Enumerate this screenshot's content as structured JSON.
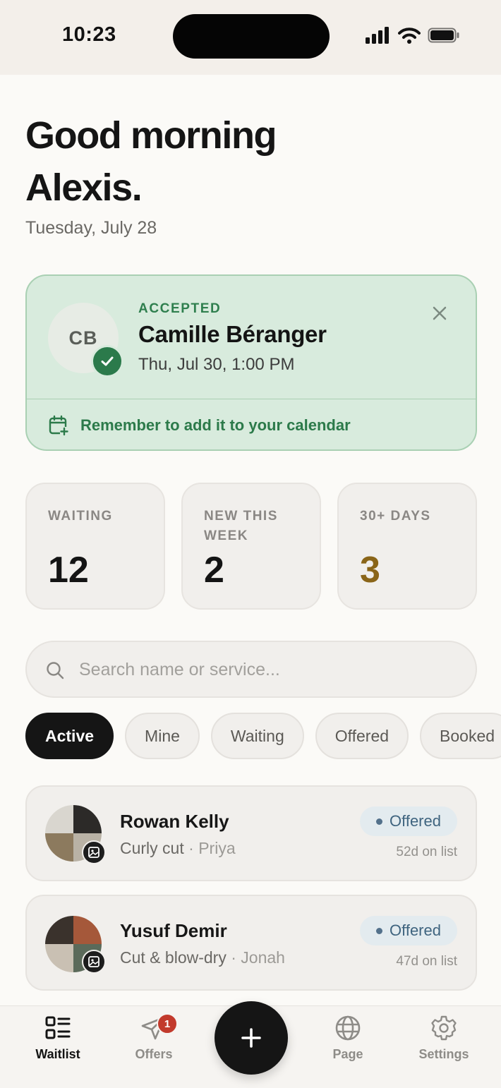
{
  "status_bar": {
    "time": "10:23"
  },
  "header": {
    "greeting_line1": "Good morning",
    "greeting_line2": "Alexis.",
    "date": "Tuesday, July 28"
  },
  "accepted_card": {
    "status_label": "ACCEPTED",
    "initials": "CB",
    "name": "Camille Béranger",
    "appointment": "Thu, Jul 30, 1:00 PM",
    "reminder": "Remember to add it to your calendar",
    "color_bg": "#d8ebdd",
    "color_accent": "#2b7a4b"
  },
  "stats": [
    {
      "label": "WAITING",
      "value": "12"
    },
    {
      "label": "NEW THIS WEEK",
      "value": "2"
    },
    {
      "label": "30+ DAYS",
      "value": "3",
      "color": "#8a6518"
    }
  ],
  "search": {
    "placeholder": "Search name or service..."
  },
  "filters": {
    "selected": "Active",
    "chips": [
      "Active",
      "Mine",
      "Waiting",
      "Offered",
      "Booked"
    ]
  },
  "clients": [
    {
      "name": "Rowan Kelly",
      "service": "Curly cut",
      "separator": " · ",
      "stylist": "Priya",
      "status": "Offered",
      "days": "52d on list"
    },
    {
      "name": "Yusuf Demir",
      "service": "Cut & blow-dry",
      "separator": " · ",
      "stylist": "Jonah",
      "status": "Offered",
      "days": "47d on list"
    }
  ],
  "tabbar": {
    "waitlist": "Waitlist",
    "offers": "Offers",
    "offers_badge": "1",
    "page": "Page",
    "settings": "Settings",
    "add_icon": "plus-icon"
  }
}
